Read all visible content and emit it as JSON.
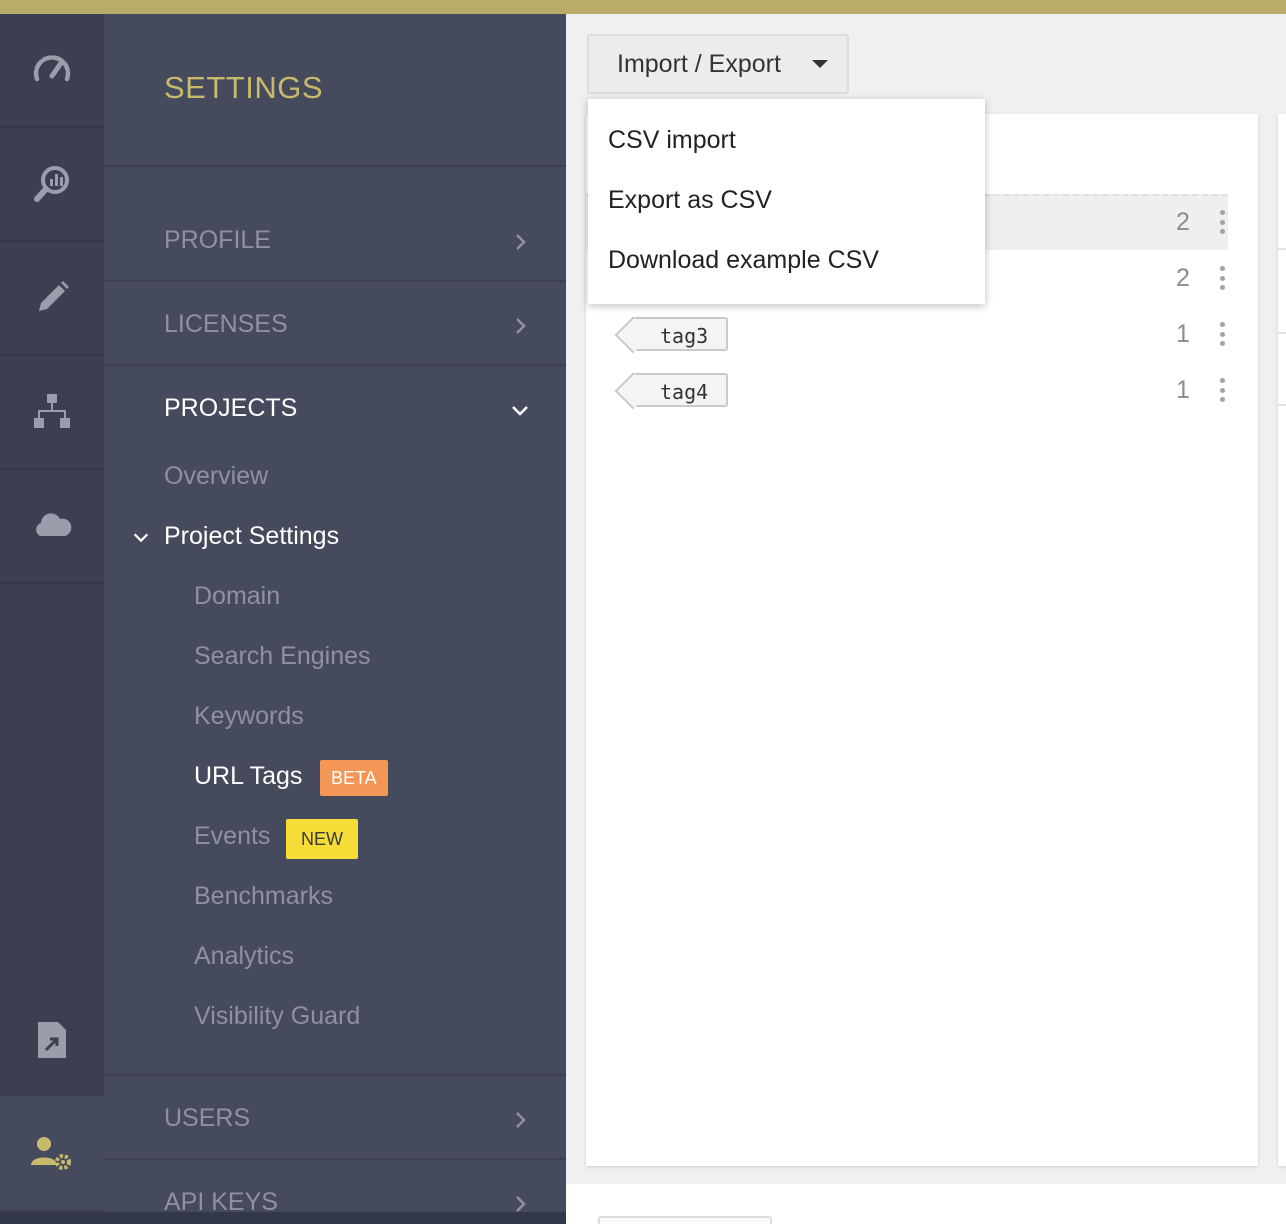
{
  "settings": {
    "title": "SETTINGS",
    "sections": {
      "profile": "PROFILE",
      "licenses": "LICENSES",
      "projects": "PROJECTS",
      "users": "USERS",
      "api_keys": "API KEYS"
    },
    "projects": {
      "overview": "Overview",
      "project_settings": "Project Settings",
      "items": {
        "domain": "Domain",
        "search_engines": "Search Engines",
        "keywords": "Keywords",
        "url_tags": "URL Tags",
        "url_tags_badge": "BETA",
        "events": "Events",
        "events_badge": "NEW",
        "benchmarks": "Benchmarks",
        "analytics": "Analytics",
        "visibility_guard": "Visibility Guard"
      }
    }
  },
  "rail_icons": [
    "gauge-icon",
    "search-chart-icon",
    "pencil-icon",
    "sitemap-icon",
    "cloud-icon",
    "file-export-icon",
    "user-settings-icon"
  ],
  "toolbar": {
    "import_export_label": "Import / Export",
    "menu": {
      "csv_import": "CSV import",
      "export_csv": "Export as CSV",
      "download_example": "Download example CSV"
    }
  },
  "tags": [
    {
      "name": "",
      "count": "2"
    },
    {
      "name": "",
      "count": "2"
    },
    {
      "name": "tag3",
      "count": "1"
    },
    {
      "name": "tag4",
      "count": "1"
    }
  ],
  "colors": {
    "accent": "#b9ab68",
    "title": "#c8ba6c",
    "rail_bg": "#3b3f51",
    "panel_bg": "#454a5c",
    "beta_badge": "#f39656",
    "new_badge": "#f6dc36"
  }
}
